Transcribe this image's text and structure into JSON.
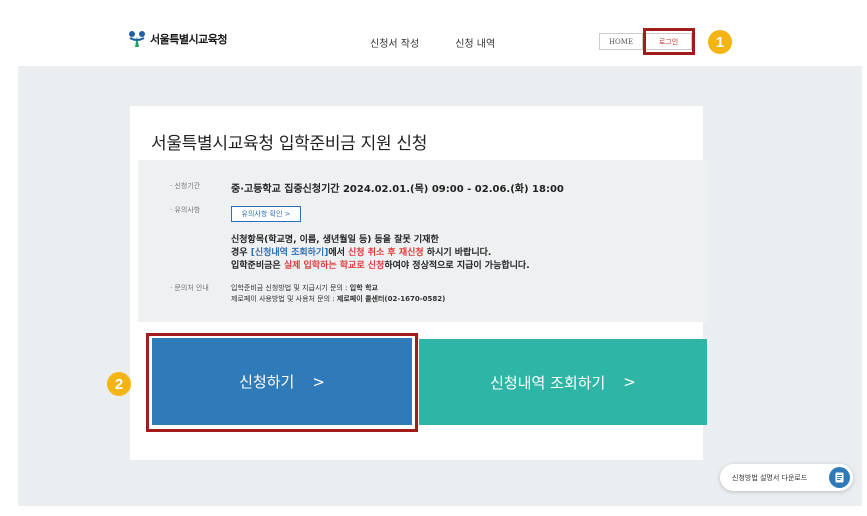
{
  "header": {
    "logo_text": "서울특별시교육청",
    "nav": [
      "신청서 작성",
      "신청 내역"
    ],
    "home_label": "HOME",
    "login_label": "로그인"
  },
  "badges": [
    "1",
    "2"
  ],
  "card": {
    "title": "서울특별시교육청 입학준비금 지원 신청",
    "period_label": "· 신청기간",
    "period_text": "중·고등학교 집중신청기간 2024.02.01.(목) 09:00 - 02.06.(화) 18:00",
    "notice_label": "· 유의사항",
    "notice_button": "유의사항 확인 >",
    "notice_line1": "신청항목(학교명, 이름, 생년월일 등) 등을 잘못 기재한",
    "notice_line2_a": "경우 ",
    "notice_line2_b": "[신청내역 조회하기]",
    "notice_line2_c": "에서 ",
    "notice_line2_d": "신청 취소 후 재신청",
    "notice_line2_e": " 하시기 바랍니다.",
    "notice_line3_a": "입학준비금은 ",
    "notice_line3_b": "실제 입학하는 학교로 신청",
    "notice_line3_c": "하여야 정상적으로 지급이 가능합니다.",
    "contact_label": "· 문의처 안내",
    "contact_line1_a": "입학준비금 신청방법 및 지급시기 문의 : ",
    "contact_line1_b": "입학 학교",
    "contact_line2_a": "제로페이 사용방법 및 사용처 문의 : ",
    "contact_line2_b": "제로페이 콜센터(02-1670-0582)"
  },
  "buttons": {
    "apply": "신청하기",
    "query": "신청내역 조회하기",
    "arrow": ">"
  },
  "download_label": "신청방법 설명서 다운로드",
  "colors": {
    "blue_button": "#2f7ab9",
    "teal_button": "#2eb5a5",
    "highlight": "#a31b1b",
    "badge": "#f4b414"
  }
}
